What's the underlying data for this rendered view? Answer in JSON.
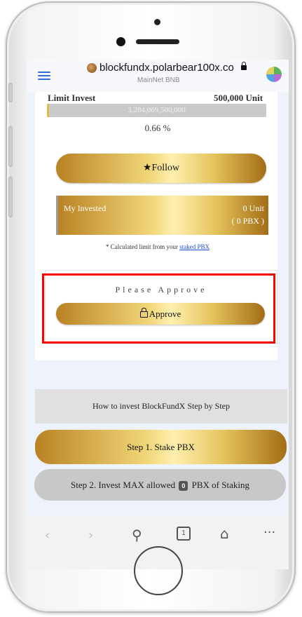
{
  "browser": {
    "url": "blockfundx.polarbear100x.co",
    "network": "MainNet BNB"
  },
  "invest": {
    "limit_label": "Limit Invest",
    "limit_value": "500,000 Unit",
    "progress_text": "3,284,069,500,000",
    "progress_fraction": 0.0066,
    "percent": "0.66 %",
    "follow_label": "Follow",
    "my_invested_label": "My Invested",
    "my_invested_units": "0 Unit",
    "my_invested_pbx": "( 0 PBX )",
    "calc_note_text": "* Calculated limit from your ",
    "calc_note_link": "staked PBX"
  },
  "approve": {
    "title": "Please Approve",
    "button_label": "Approve"
  },
  "steps": {
    "how_to": "How to invest BlockFundX Step by Step",
    "step1": "Step 1. Stake PBX",
    "step2_prefix": "Step 2. Invest MAX allowed",
    "step2_badge": "0",
    "step2_suffix": "PBX of Staking"
  },
  "navbar": {
    "back_glyph": "‹",
    "forward_glyph": "›",
    "search_glyph": "⚲",
    "tabs_count": "1",
    "home_glyph": "⌂",
    "more_glyph": "···"
  },
  "colors": {
    "highlight": "#ff0000",
    "link": "#1d4ed8",
    "menu": "#2f6fd6"
  }
}
